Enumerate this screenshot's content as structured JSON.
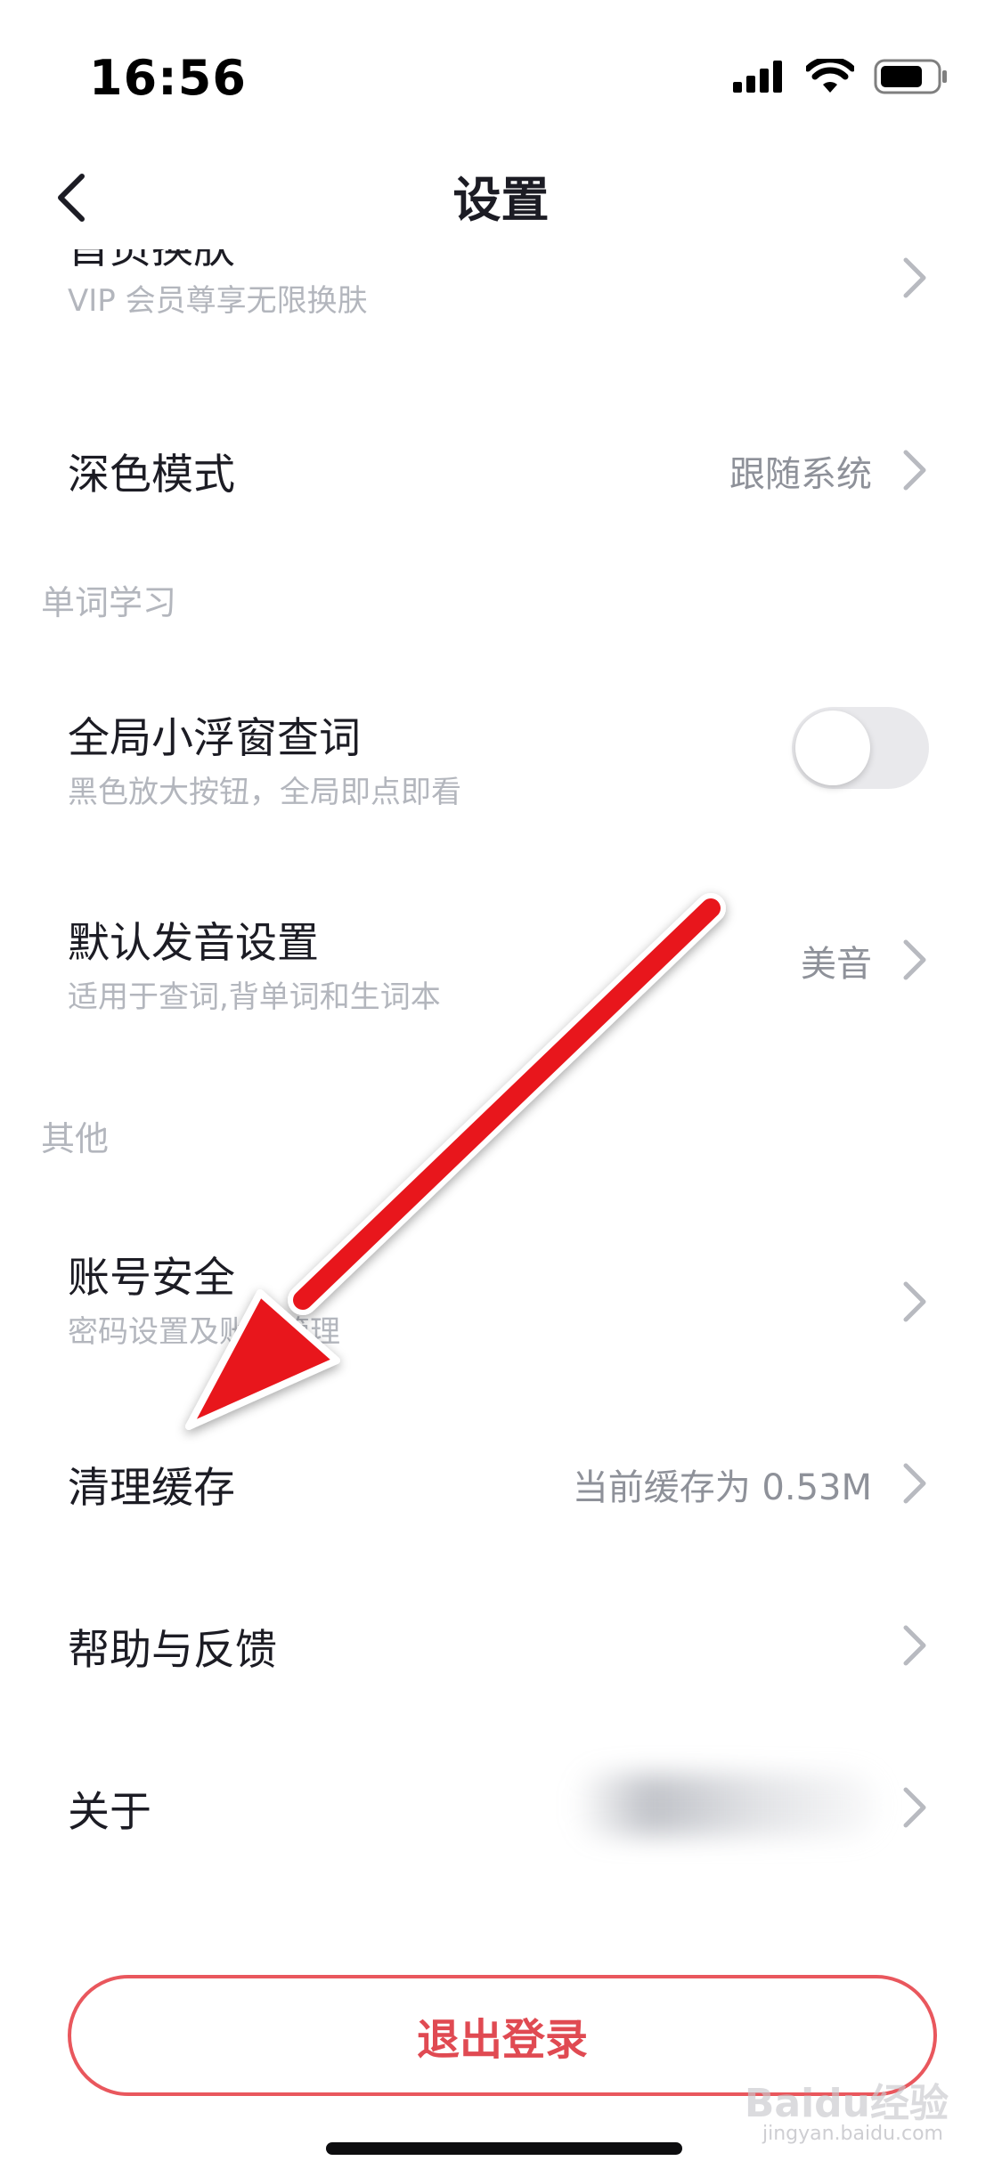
{
  "status_bar": {
    "time": "16:56"
  },
  "nav": {
    "title": "设置"
  },
  "rows": {
    "skin": {
      "title": "首页换肤",
      "subtitle": "VIP 会员尊享无限换肤"
    },
    "dark_mode": {
      "title": "深色模式",
      "value": "跟随系统"
    },
    "floating_lookup": {
      "title": "全局小浮窗查词",
      "subtitle": "黑色放大按钮，全局即点即看",
      "toggle_on": false
    },
    "pronunciation": {
      "title": "默认发音设置",
      "subtitle": "适用于查词,背单词和生词本",
      "value": "美音"
    },
    "account": {
      "title": "账号安全",
      "subtitle": "密码设置及账号管理"
    },
    "cache": {
      "title": "清理缓存",
      "value": "当前缓存为 0.53M"
    },
    "help": {
      "title": "帮助与反馈"
    },
    "about": {
      "title": "关于"
    }
  },
  "sections": {
    "word_learning": "单词学习",
    "other": "其他"
  },
  "logout": {
    "label": "退出登录"
  },
  "watermark": {
    "brand": "Baidu经验",
    "url": "jingyan.baidu.com"
  },
  "colors": {
    "accent_red": "#e04a52",
    "annotation_arrow": "#e8141c"
  },
  "icons": [
    "back-icon",
    "chevron-right-icon",
    "signal-icon",
    "wifi-icon",
    "battery-icon"
  ]
}
